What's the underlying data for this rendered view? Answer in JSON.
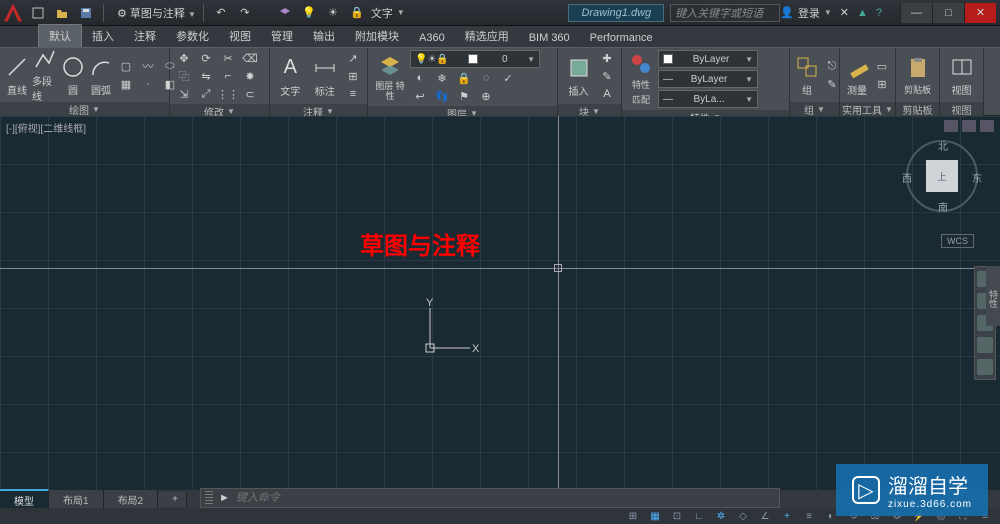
{
  "titlebar": {
    "workspace": "草图与注释",
    "dropdown2": "文字",
    "document": "Drawing1.dwg",
    "search_placeholder": "键入关键字或短语",
    "login": "登录"
  },
  "tabs": [
    "默认",
    "插入",
    "注释",
    "参数化",
    "视图",
    "管理",
    "输出",
    "附加模块",
    "A360",
    "精选应用",
    "BIM 360",
    "Performance"
  ],
  "active_tab": 0,
  "ribbon": {
    "draw": {
      "title": "绘图",
      "btns": {
        "line": "直线",
        "polyline": "多段线",
        "circle": "圆",
        "arc": "圆弧"
      }
    },
    "modify": {
      "title": "修改"
    },
    "annotate": {
      "title": "注释",
      "btns": {
        "text": "文字",
        "dim": "标注"
      },
      "combo1": "文字"
    },
    "layers": {
      "title": "图层",
      "btn": "图层\n特性",
      "current": "0"
    },
    "block": {
      "title": "块",
      "btn": "插入"
    },
    "props": {
      "title": "特性",
      "btn": "特性",
      "match": "匹配",
      "layer1": "ByLayer",
      "layer2": "ByLayer",
      "layer3": "ByLa..."
    },
    "group": {
      "title": "组",
      "btn": "组"
    },
    "util": {
      "title": "实用工具",
      "btn": "测量"
    },
    "clip": {
      "title": "剪贴板",
      "btn": "剪贴板"
    },
    "view": {
      "title": "视图",
      "btn": "视图"
    }
  },
  "viewport": {
    "label": "[-][俯视][二维线框]",
    "ucs": {
      "x": "X",
      "y": "Y"
    },
    "annotation": "草图与注释",
    "viewcube": {
      "n": "北",
      "s": "南",
      "e": "东",
      "w": "西",
      "top": "上"
    },
    "wcs": "WCS"
  },
  "side_tab": "特性",
  "cmdline": {
    "prompt": "►",
    "placeholder": "键入命令"
  },
  "layout_tabs": [
    "模型",
    "布局1",
    "布局2"
  ],
  "layout_add": "+",
  "watermark": {
    "title": "溜溜自学",
    "url": "zixue.3d66.com"
  }
}
